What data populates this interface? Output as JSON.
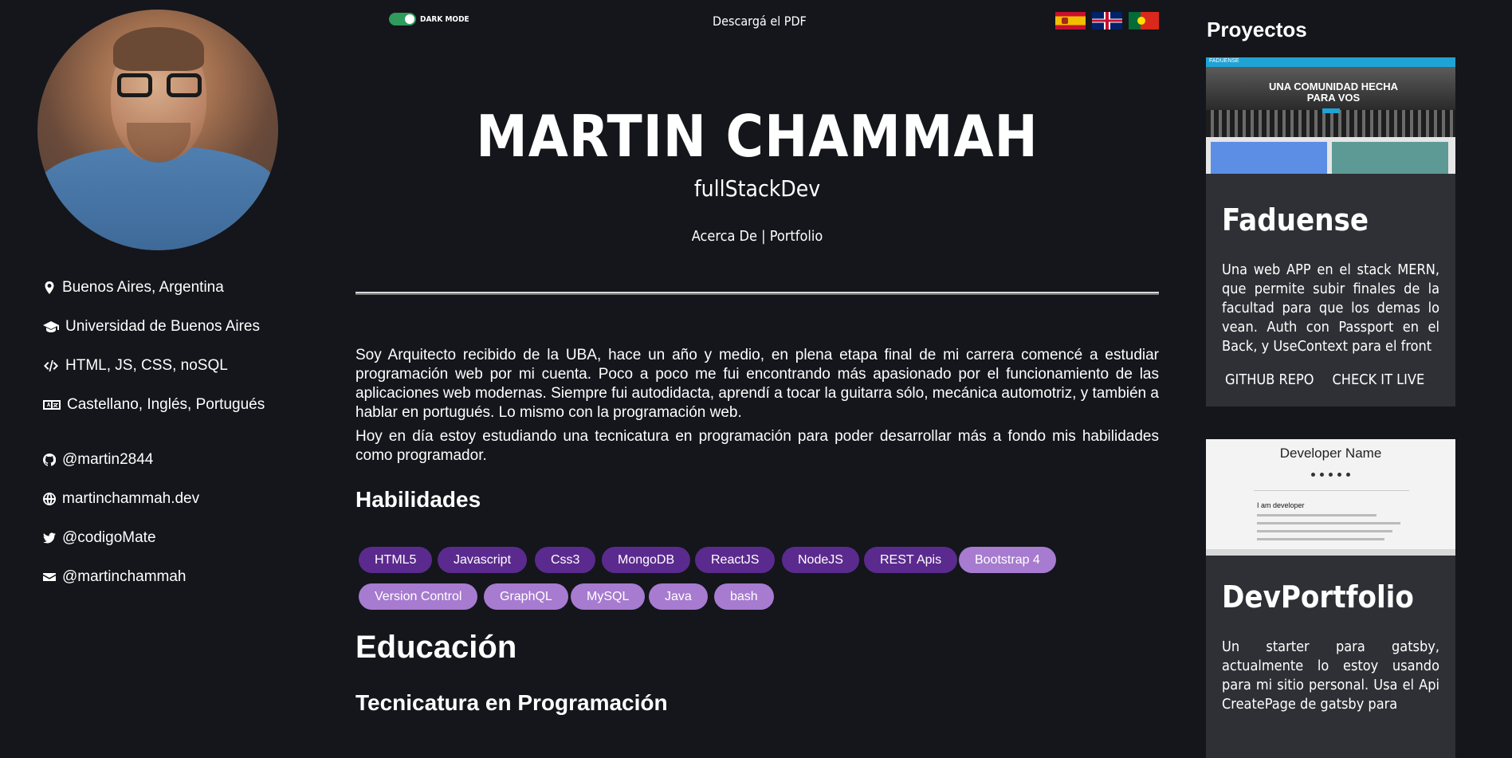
{
  "profile": {
    "info": [
      {
        "icon": "map-marker-icon",
        "text": "Buenos Aires, Argentina"
      },
      {
        "icon": "graduation-cap-icon",
        "text": "Universidad de Buenos Aires"
      },
      {
        "icon": "code-icon",
        "text": "HTML, JS, CSS, noSQL"
      },
      {
        "icon": "language-icon",
        "text": "Castellano, Inglés, Portugués"
      }
    ],
    "links": [
      {
        "icon": "github-icon",
        "text": "@martin2844"
      },
      {
        "icon": "globe-icon",
        "text": "martinchammah.dev"
      },
      {
        "icon": "twitter-icon",
        "text": "@codigoMate"
      },
      {
        "icon": "envelope-icon",
        "text": "@martinchammah"
      }
    ]
  },
  "topbar": {
    "dark_mode_label": "DARK MODE",
    "dark_mode_on": true,
    "pdf_link": "Descargá el PDF",
    "languages": [
      "es",
      "en",
      "pt"
    ]
  },
  "header": {
    "name": "MARTIN CHAMMAH",
    "role": "fullStackDev",
    "nav": {
      "about": "Acerca De",
      "separator": " | ",
      "portfolio": "Portfolio"
    }
  },
  "about": {
    "paragraphs": [
      "Soy Arquitecto recibido de la UBA, hace un año y medio, en plena etapa final de mi carrera comencé a estudiar programación web por mi cuenta. Poco a poco me fui encontrando más apasionado por el funcionamiento de las aplicaciones web modernas. Siempre fui autodidacta, aprendí a tocar la guitarra sólo, mecánica automotriz, y también a hablar en portugués. Lo mismo con la programación web.",
      "Hoy en día estoy estudiando una tecnicatura en programación para poder desarrollar más a fondo mis habilidades como programador."
    ]
  },
  "skills": {
    "title": "Habilidades",
    "items": [
      {
        "label": "HTML5",
        "tone": "dark"
      },
      {
        "label": "Javascript",
        "tone": "dark"
      },
      {
        "label": "Css3",
        "tone": "dark"
      },
      {
        "label": "MongoDB",
        "tone": "dark"
      },
      {
        "label": "ReactJS",
        "tone": "dark"
      },
      {
        "label": "NodeJS",
        "tone": "dark"
      },
      {
        "label": "REST Apis",
        "tone": "dark"
      },
      {
        "label": "Bootstrap 4",
        "tone": "light"
      },
      {
        "label": "Version Control",
        "tone": "light"
      },
      {
        "label": "GraphQL",
        "tone": "light"
      },
      {
        "label": "MySQL",
        "tone": "light"
      },
      {
        "label": "Java",
        "tone": "light"
      },
      {
        "label": "bash",
        "tone": "light"
      }
    ]
  },
  "education": {
    "title": "Educación",
    "first_item": "Tecnicatura en Programación"
  },
  "projects": {
    "title": "Proyectos",
    "cards": [
      {
        "name": "Faduense",
        "thumb_brand": "FADUENSE",
        "thumb_tagline": "UNA COMUNIDAD HECHA PARA VOS",
        "description": "Una web APP en el stack MERN, que permite subir finales de la facultad para que los demas lo vean. Auth con Passport en el Back, y UseContext para el front",
        "repo_label": "GITHUB REPO",
        "live_label": "CHECK IT LIVE"
      },
      {
        "name": "DevPortfolio",
        "thumb_title": "Developer Name",
        "thumb_heading": "I am developer",
        "description": "Un starter para gatsby, actualmente lo estoy usando para mi sitio personal. Usa el Api CreatePage de gatsby para"
      }
    ]
  },
  "colors": {
    "background": "#14161b",
    "card": "#2e3035",
    "chip_dark": "#5b2a8e",
    "chip_light": "#a77bd0",
    "toggle_on": "#2f9b5c"
  }
}
